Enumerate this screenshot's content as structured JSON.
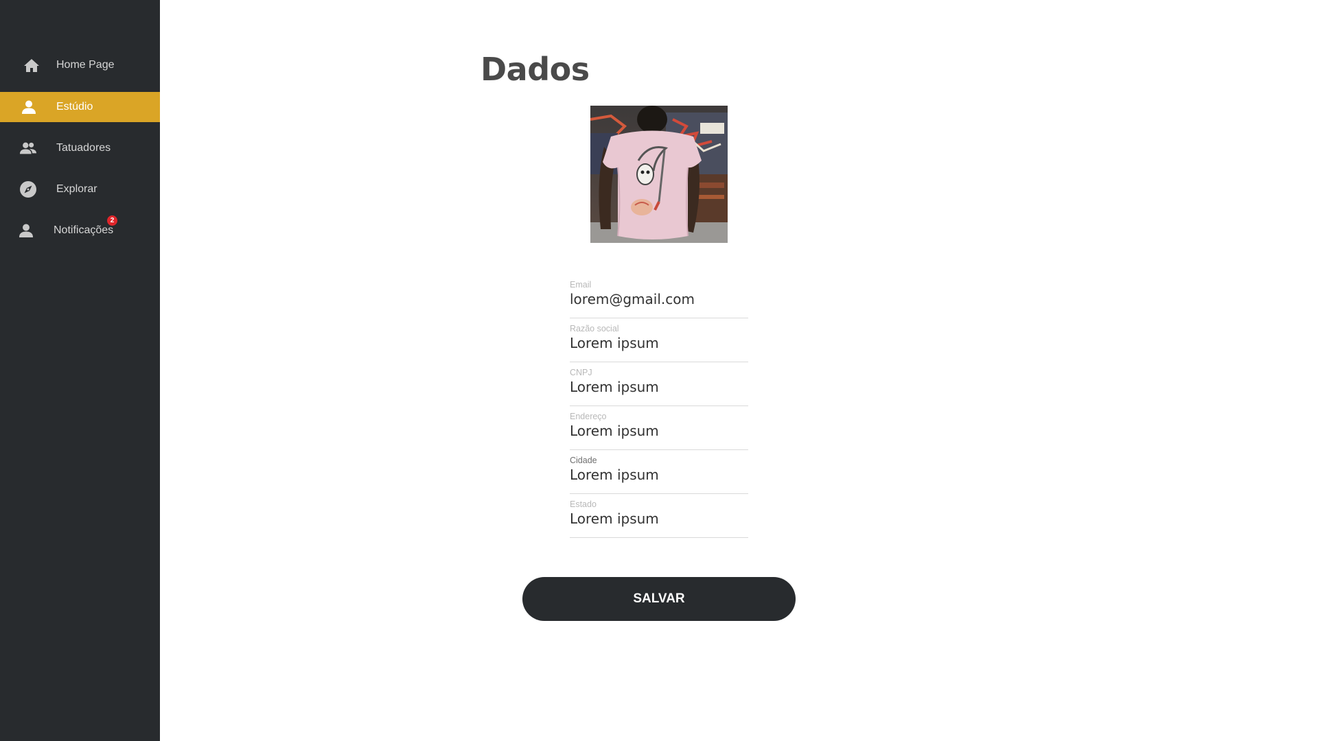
{
  "sidebar": {
    "items": [
      {
        "label": "Home Page",
        "icon": "home-icon",
        "active": false
      },
      {
        "label": "Estúdio",
        "icon": "person-icon",
        "active": true
      },
      {
        "label": "Tatuadores",
        "icon": "people-icon",
        "active": false
      },
      {
        "label": "Explorar",
        "icon": "compass-icon",
        "active": false
      },
      {
        "label": "Notificações",
        "icon": "person-icon",
        "active": false,
        "badge": "2"
      }
    ]
  },
  "main": {
    "title": "Dados",
    "avatar_alt": "profile-photo",
    "fields": [
      {
        "label": "Email",
        "value": "lorem@gmail.com"
      },
      {
        "label": "Razão social",
        "value": "Lorem ipsum"
      },
      {
        "label": "CNPJ",
        "value": "Lorem ipsum"
      },
      {
        "label": "Endereço",
        "value": "Lorem ipsum"
      },
      {
        "label": "Cidade",
        "value": "Lorem ipsum"
      },
      {
        "label": "Estado",
        "value": "Lorem ipsum"
      }
    ],
    "save_label": "SALVAR"
  },
  "colors": {
    "sidebar_bg": "#282b2e",
    "accent": "#daa526",
    "badge": "#e0262b",
    "button_bg": "#282b2e"
  }
}
